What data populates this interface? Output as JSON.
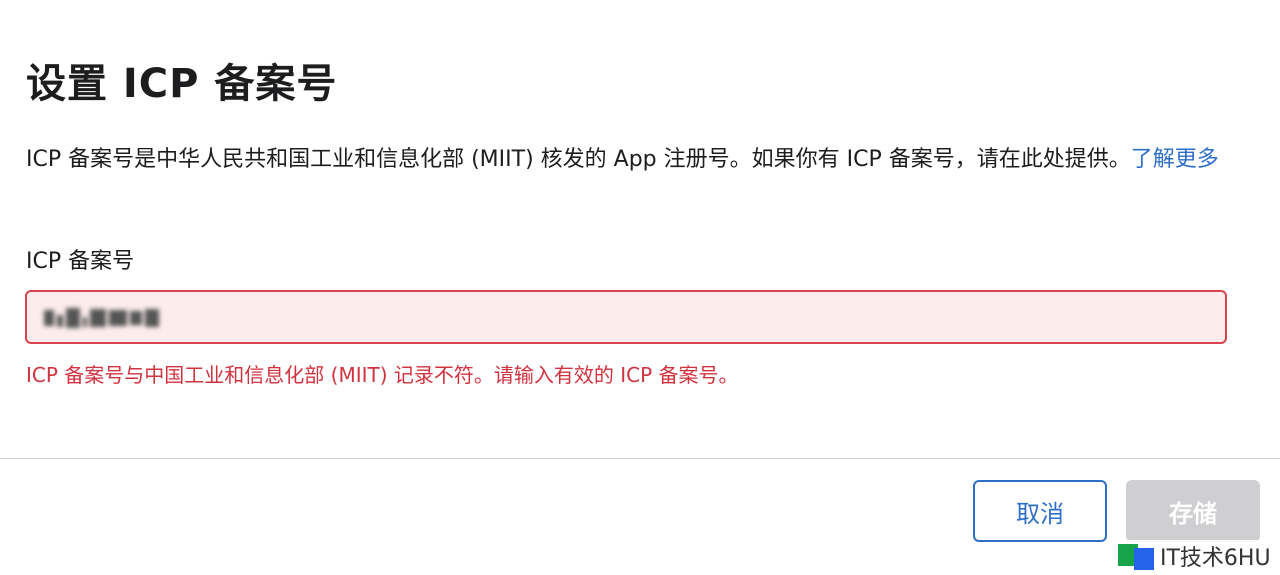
{
  "dialog": {
    "title": "设置 ICP 备案号",
    "description": "ICP 备案号是中华人民共和国工业和信息化部 (MIIT) 核发的 App 注册号。如果你有 ICP 备案号，请在此处提供。",
    "learn_more_link": "了解更多",
    "field": {
      "label": "ICP 备案号",
      "value": "",
      "state": "error"
    },
    "error_message": "ICP 备案号与中国工业和信息化部 (MIIT) 记录不符。请输入有效的 ICP 备案号。",
    "buttons": {
      "cancel_label": "取消",
      "save_label": "存储"
    }
  },
  "watermark": {
    "text": "IT技术6HU"
  },
  "colors": {
    "link": "#2e6fc9",
    "error": "#d0333f",
    "error_bg": "#fcecec",
    "disabled_button": "#cfcfd2"
  }
}
